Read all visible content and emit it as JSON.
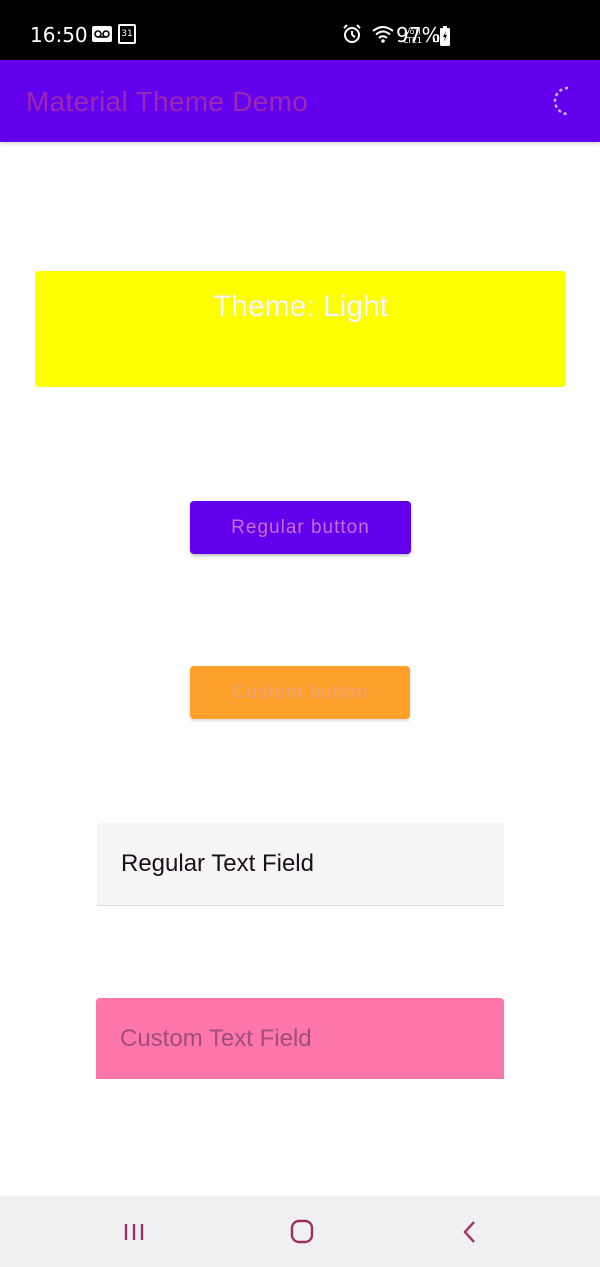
{
  "status_bar": {
    "time": "16:50",
    "calendar_day": "31",
    "network_label_top": "Vo))",
    "network_label_bottom": "LTE1",
    "battery_percent": "97%",
    "icons": [
      "voicemail-icon",
      "calendar-icon",
      "alarm-icon",
      "wifi-icon",
      "volte-icon",
      "signal-icon",
      "battery-charging-icon"
    ]
  },
  "app_bar": {
    "title": "Material Theme Demo",
    "background_color": "#6200ee",
    "title_color": "#9c27b0",
    "action_icon": "dark-mode-toggle-icon"
  },
  "theme_banner": {
    "label": "Theme: Light",
    "background_color": "#ffff00"
  },
  "buttons": {
    "regular": {
      "label": "Regular button",
      "background_color": "#6200ee"
    },
    "custom": {
      "label": "Custom button",
      "background_color": "#ffa02a"
    }
  },
  "fields": {
    "regular": {
      "value": "Regular Text Field",
      "background_color": "#f5f5f5"
    },
    "custom": {
      "value": "Custom Text Field",
      "background_color": "#ff77aa"
    }
  },
  "nav_bar": {
    "buttons": [
      "recent-apps-icon",
      "home-icon",
      "back-icon"
    ],
    "icon_color": "#9c2f63"
  }
}
